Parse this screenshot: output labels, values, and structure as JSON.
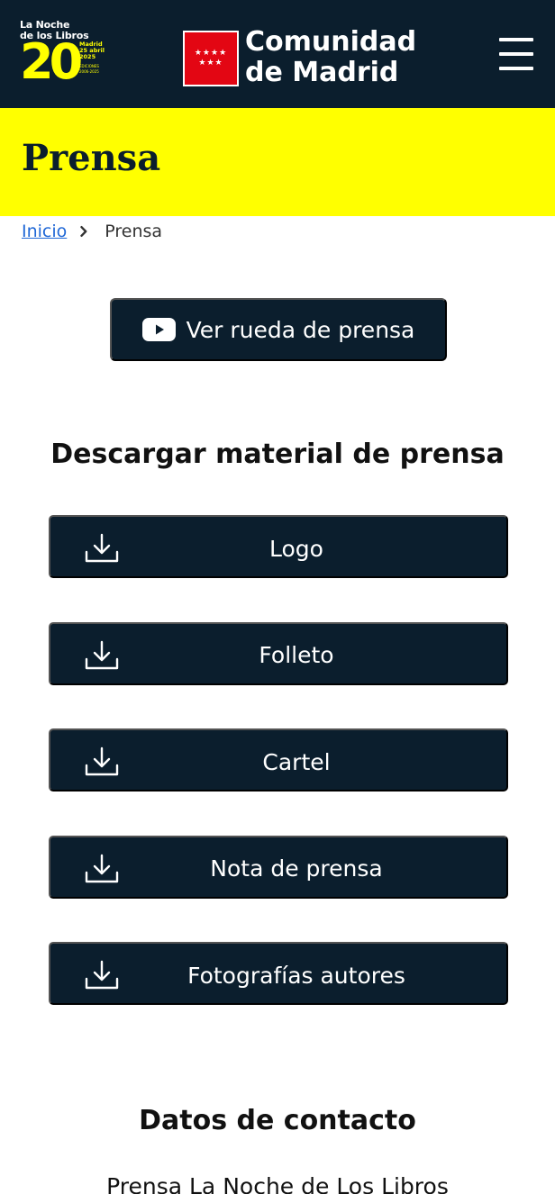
{
  "header": {
    "event_logo": {
      "line1": "La Noche",
      "line2": "de los Libros",
      "number": "20",
      "city": "Madrid",
      "date": "25 abril",
      "year": "2025",
      "editions_label": "EDICIONES",
      "editions_range": "2006-2025"
    },
    "org_logo": {
      "line1": "Comunidad",
      "line2": "de Madrid",
      "stars": "★★★★ ★★★"
    },
    "menu_icon": "hamburger-menu-icon"
  },
  "page": {
    "title": "Prensa"
  },
  "breadcrumb": {
    "home": "Inicio",
    "current": "Prensa"
  },
  "video_button": {
    "label": "Ver rueda de prensa",
    "icon": "youtube-icon"
  },
  "downloads": {
    "title": "Descargar material de prensa",
    "icon": "download-icon",
    "items": [
      {
        "label": "Logo"
      },
      {
        "label": "Folleto"
      },
      {
        "label": "Cartel"
      },
      {
        "label": "Nota de prensa"
      },
      {
        "label": "Fotografías autores"
      }
    ]
  },
  "contact": {
    "title": "Datos de contacto",
    "name": "Prensa La Noche de Los Libros"
  },
  "colors": {
    "navy": "#0b1e2d",
    "yellow": "#ffff00",
    "link_blue": "#1f67d6",
    "madrid_red": "#e30613"
  }
}
